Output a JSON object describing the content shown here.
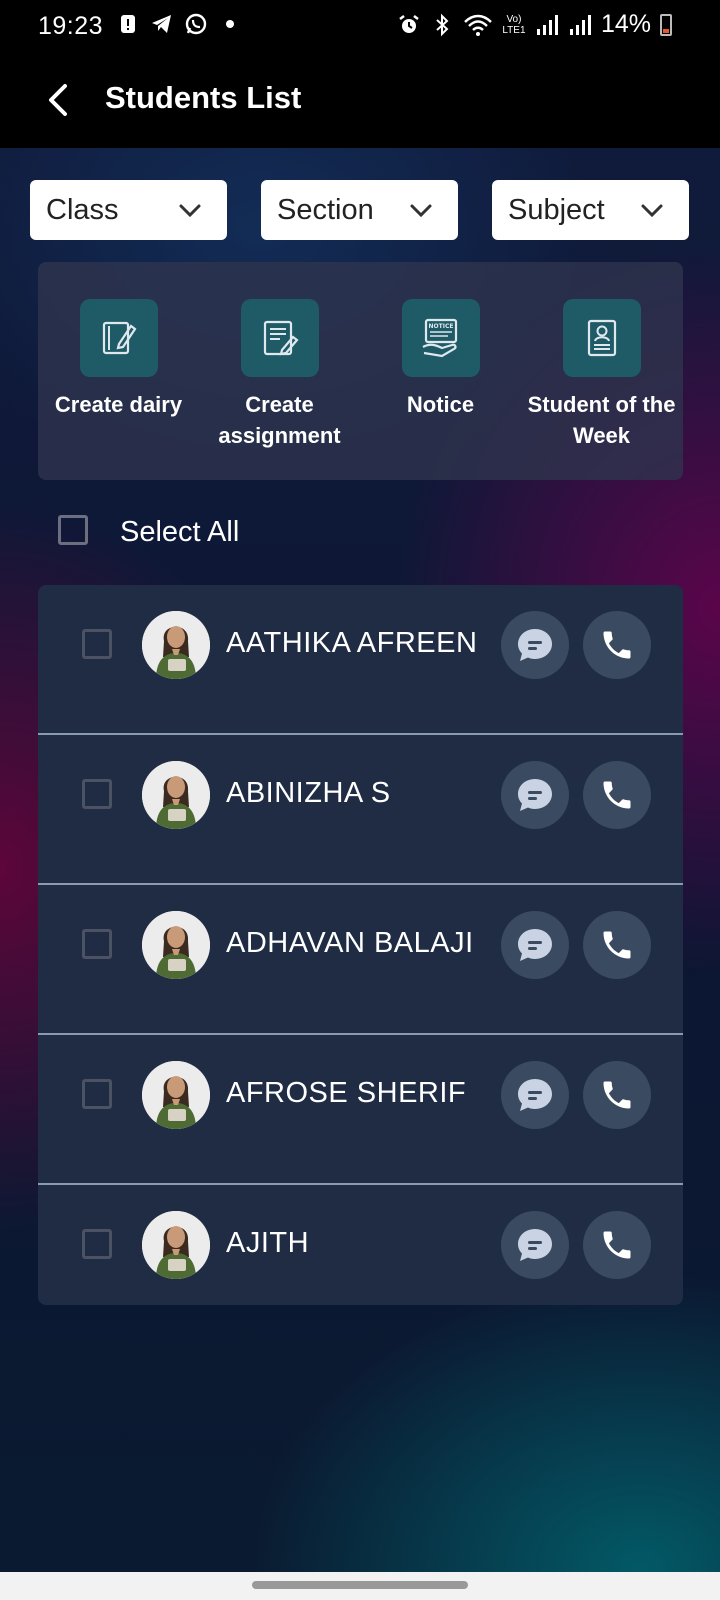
{
  "status_bar": {
    "time": "19:23",
    "battery": "14%",
    "network_label": "Vo) LTE1"
  },
  "app_bar": {
    "title": "Students List"
  },
  "filters": [
    {
      "label": "Class"
    },
    {
      "label": "Section"
    },
    {
      "label": "Subject"
    }
  ],
  "actions": [
    {
      "label": "Create dairy",
      "icon": "diary-edit-icon"
    },
    {
      "label": "Create assignment",
      "icon": "assignment-edit-icon"
    },
    {
      "label": "Notice",
      "icon": "notice-board-icon"
    },
    {
      "label": "Student of the Week",
      "icon": "student-badge-icon"
    }
  ],
  "select_all": {
    "label": "Select All",
    "checked": false
  },
  "students": [
    {
      "name": "AATHIKA AFREEN",
      "checked": false
    },
    {
      "name": "ABINIZHA S",
      "checked": false
    },
    {
      "name": "ADHAVAN BALAJI",
      "checked": false
    },
    {
      "name": "AFROSE SHERIF",
      "checked": false
    },
    {
      "name": "AJITH",
      "checked": false
    }
  ],
  "colors": {
    "accent_tile": "#1f5a67",
    "list_bg": "#1f2c44",
    "round_button": "#3a4a60",
    "message_bubble": "#c9d3e3"
  }
}
